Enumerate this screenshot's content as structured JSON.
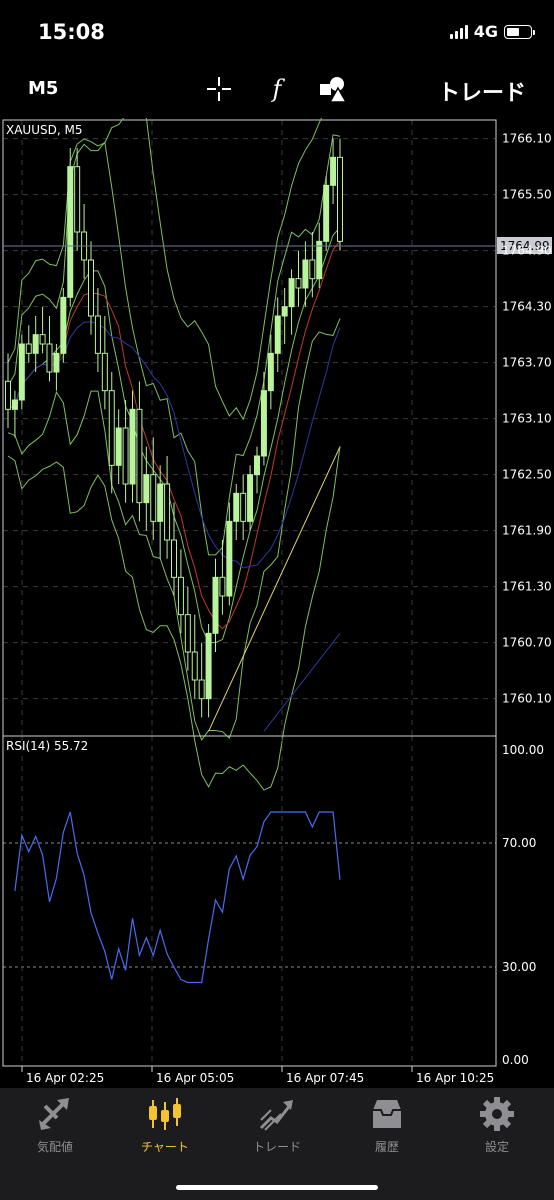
{
  "status_bar": {
    "time": "15:08",
    "network": "4G"
  },
  "toolbar": {
    "timeframe": "M5",
    "trade_label": "トレード",
    "icons": [
      "crosshair-icon",
      "function-icon",
      "objects-icon"
    ]
  },
  "main_chart": {
    "symbol_label": "XAUUSD, M5",
    "current_price": "1764.99",
    "price_ticks": [
      "1766.10",
      "1765.50",
      "1764.90",
      "1764.30",
      "1763.70",
      "1763.10",
      "1762.50",
      "1761.90",
      "1761.30",
      "1760.70",
      "1760.10"
    ]
  },
  "rsi": {
    "label": "RSI(14) 55.72",
    "ticks": [
      "100.00",
      "70.00",
      "30.00",
      "0.00"
    ]
  },
  "time_axis": [
    "16 Apr 02:25",
    "16 Apr 05:05",
    "16 Apr 07:45",
    "16 Apr 10:25"
  ],
  "chart_data": {
    "type": "candlestick",
    "title": "XAUUSD, M5",
    "ylim": [
      1759.7,
      1766.3
    ],
    "current_price": 1764.99,
    "candles": [
      [
        1763.5,
        1763.8,
        1763.0,
        1763.2
      ],
      [
        1763.2,
        1763.4,
        1762.9,
        1763.3
      ],
      [
        1763.3,
        1764.0,
        1763.2,
        1763.9
      ],
      [
        1763.9,
        1764.1,
        1763.7,
        1763.8
      ],
      [
        1763.8,
        1764.2,
        1763.6,
        1764.0
      ],
      [
        1764.0,
        1764.3,
        1763.8,
        1763.9
      ],
      [
        1763.9,
        1764.2,
        1763.5,
        1763.6
      ],
      [
        1763.6,
        1763.9,
        1763.4,
        1763.8
      ],
      [
        1763.8,
        1764.5,
        1763.7,
        1764.4
      ],
      [
        1764.4,
        1766.0,
        1764.3,
        1765.8
      ],
      [
        1765.8,
        1766.0,
        1764.9,
        1765.1
      ],
      [
        1765.1,
        1765.4,
        1764.6,
        1764.8
      ],
      [
        1764.8,
        1765.0,
        1764.0,
        1764.2
      ],
      [
        1764.2,
        1764.5,
        1763.6,
        1763.8
      ],
      [
        1763.8,
        1764.2,
        1763.2,
        1763.4
      ],
      [
        1763.4,
        1763.6,
        1762.3,
        1762.6
      ],
      [
        1762.6,
        1763.2,
        1762.4,
        1763.0
      ],
      [
        1763.0,
        1763.3,
        1762.2,
        1762.4
      ],
      [
        1762.4,
        1763.4,
        1762.2,
        1763.2
      ],
      [
        1763.2,
        1763.5,
        1762.0,
        1762.2
      ],
      [
        1762.2,
        1762.8,
        1761.9,
        1762.5
      ],
      [
        1762.5,
        1762.9,
        1761.8,
        1762.0
      ],
      [
        1762.0,
        1762.6,
        1761.6,
        1762.4
      ],
      [
        1762.4,
        1762.7,
        1761.6,
        1761.8
      ],
      [
        1761.8,
        1762.2,
        1761.2,
        1761.4
      ],
      [
        1761.4,
        1761.7,
        1760.8,
        1761.0
      ],
      [
        1761.0,
        1761.3,
        1760.4,
        1760.6
      ],
      [
        1760.6,
        1761.0,
        1760.1,
        1760.3
      ],
      [
        1760.3,
        1760.7,
        1759.9,
        1760.1
      ],
      [
        1760.1,
        1760.9,
        1759.9,
        1760.8
      ],
      [
        1760.8,
        1761.6,
        1760.6,
        1761.4
      ],
      [
        1761.4,
        1761.8,
        1761.0,
        1761.2
      ],
      [
        1761.2,
        1762.2,
        1761.1,
        1762.0
      ],
      [
        1762.0,
        1762.4,
        1761.8,
        1762.3
      ],
      [
        1762.3,
        1762.5,
        1761.8,
        1762.0
      ],
      [
        1762.0,
        1762.6,
        1761.9,
        1762.5
      ],
      [
        1762.5,
        1762.8,
        1762.3,
        1762.7
      ],
      [
        1762.7,
        1763.6,
        1762.6,
        1763.4
      ],
      [
        1763.4,
        1764.0,
        1763.2,
        1763.8
      ],
      [
        1763.8,
        1764.4,
        1763.6,
        1764.2
      ],
      [
        1764.2,
        1764.5,
        1763.9,
        1764.3
      ],
      [
        1764.3,
        1764.7,
        1764.0,
        1764.6
      ],
      [
        1764.6,
        1764.9,
        1764.3,
        1764.5
      ],
      [
        1764.5,
        1765.0,
        1764.3,
        1764.8
      ],
      [
        1764.8,
        1765.1,
        1764.4,
        1764.6
      ],
      [
        1764.6,
        1765.2,
        1764.5,
        1765.0
      ],
      [
        1765.0,
        1765.7,
        1764.9,
        1765.6
      ],
      [
        1765.6,
        1766.1,
        1765.4,
        1765.9
      ],
      [
        1765.9,
        1766.1,
        1764.9,
        1765.0
      ]
    ]
  },
  "nav": {
    "items": [
      {
        "label": "気配値",
        "icon": "quotes-icon",
        "active": false
      },
      {
        "label": "チャート",
        "icon": "candlestick-icon",
        "active": true
      },
      {
        "label": "トレード",
        "icon": "trade-icon",
        "active": false
      },
      {
        "label": "履歴",
        "icon": "history-icon",
        "active": false
      },
      {
        "label": "設定",
        "icon": "settings-icon",
        "active": false
      }
    ]
  },
  "colors": {
    "candle": "#b9f39c",
    "bollinger": "#7fbf5f",
    "ma_red": "#c0392b",
    "ma_blue": "#2b3aa0",
    "trend_yellow": "#e6d36a",
    "rsi_line": "#4a6cf0",
    "active_nav": "#f4c430"
  }
}
